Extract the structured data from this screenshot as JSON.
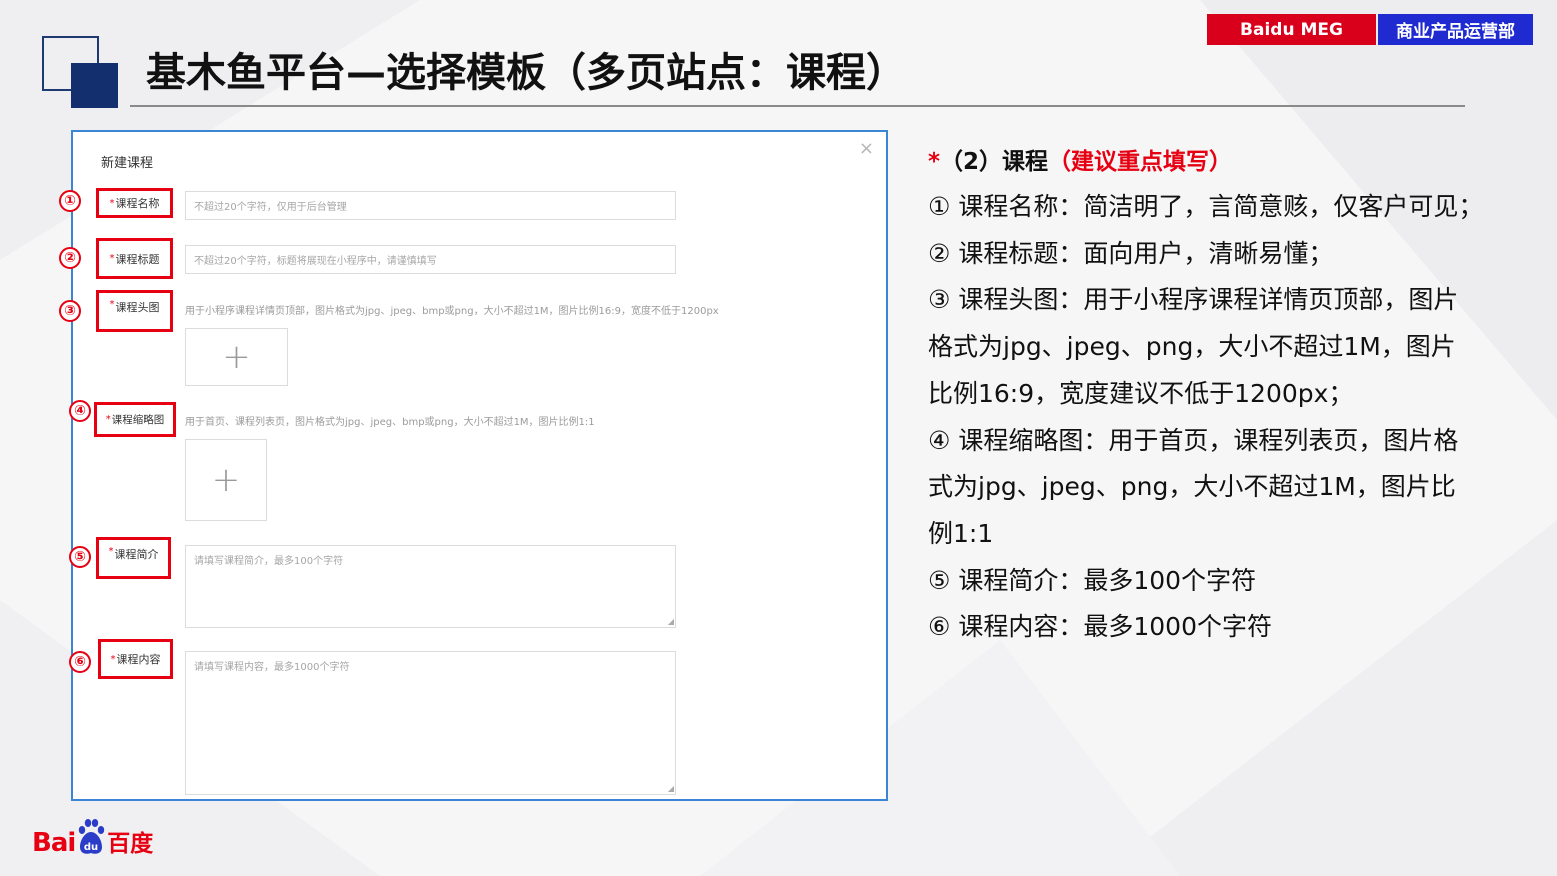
{
  "header": {
    "title": "基木鱼平台—选择模板（多页站点：课程）",
    "badge_left": "Baidu MEG",
    "badge_right": "商业产品运营部",
    "colors": {
      "brand_red": "#d9001b",
      "brand_blue": "#1f2bd0",
      "navy": "#142f6e"
    }
  },
  "form": {
    "title": "新建课程",
    "close_icon": "×",
    "fields": [
      {
        "num": "①",
        "label": "课程名称",
        "placeholder": "不超过20个字符，仅用于后台管理"
      },
      {
        "num": "②",
        "label": "课程标题",
        "placeholder": "不超过20个字符，标题将展现在小程序中，请谨慎填写"
      },
      {
        "num": "③",
        "label": "课程头图",
        "hint": "用于小程序课程详情页顶部，图片格式为jpg、jpeg、bmp或png，大小不超过1M，图片比例16:9，宽度不低于1200px",
        "upload_icon": "+"
      },
      {
        "num": "④",
        "label": "课程缩略图",
        "hint": "用于首页、课程列表页，图片格式为jpg、jpeg、bmp或png，大小不超过1M，图片比例1:1",
        "upload_icon": "+"
      },
      {
        "num": "⑤",
        "label": "课程简介",
        "placeholder": "请填写课程简介，最多100个字符"
      },
      {
        "num": "⑥",
        "label": "课程内容",
        "placeholder": "请填写课程内容，最多1000个字符"
      }
    ],
    "required_mark": "*"
  },
  "notes": {
    "heading_star": "*",
    "heading_main": "（2）课程",
    "heading_emphasis": "（建议重点填写）",
    "lines": [
      "① 课程名称：简洁明了，言简意赅，仅客户可见；",
      "② 课程标题：面向用户，清晰易懂；",
      "③ 课程头图：用于小程序课程详情页顶部，图片",
      "格式为jpg、jpeg、png，大小不超过1M，图片",
      "比例16:9，宽度建议不低于1200px；",
      "④ 课程缩略图：用于首页，课程列表页，图片格",
      "式为jpg、jpeg、png，大小不超过1M，图片比",
      "例1:1",
      "⑤ 课程简介：最多100个字符",
      "⑥ 课程内容：最多1000个字符"
    ]
  },
  "footer": {
    "logo_latin_a": "Bai",
    "logo_paw_text": "du",
    "logo_cn": "百度"
  }
}
